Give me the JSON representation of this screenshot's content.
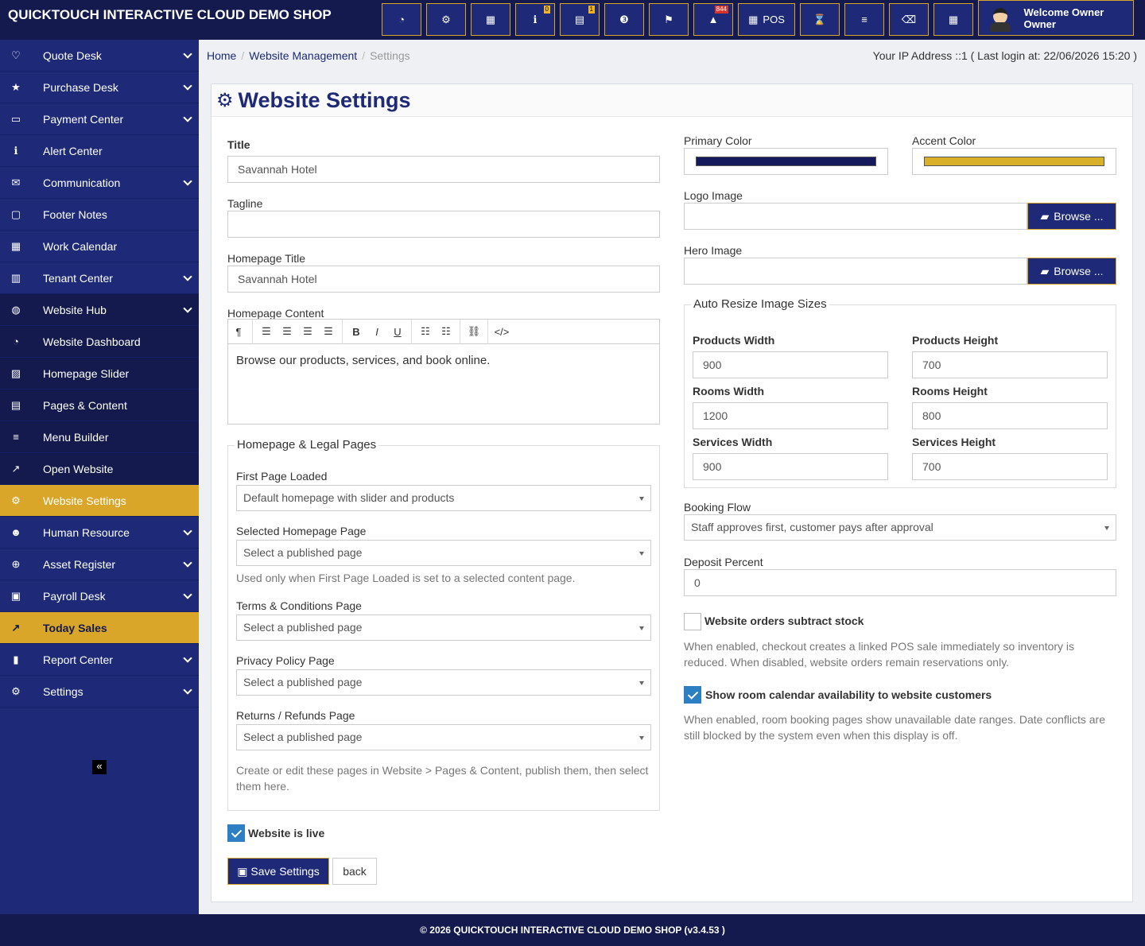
{
  "app": {
    "brand": "QUICKTOUCH INTERACTIVE CLOUD DEMO SHOP",
    "footer": "© 2026 QUICKTOUCH INTERACTIVE CLOUD DEMO SHOP (v3.4.53 )",
    "colors": {
      "primary": "#1e2a78",
      "dark": "#141a4d",
      "accent": "#d9a62a",
      "check": "#2d7fc4"
    }
  },
  "topbar": {
    "buttons": [
      {
        "icon": "dashboard-icon",
        "glyph": "◔"
      },
      {
        "icon": "cogs-icon",
        "glyph": "⚙"
      },
      {
        "icon": "calculator-icon",
        "glyph": "▦"
      },
      {
        "icon": "info-icon",
        "glyph": "ℹ",
        "badge": "0"
      },
      {
        "icon": "calendar-icon",
        "glyph": "▤",
        "badge": "1"
      },
      {
        "icon": "css3-icon",
        "glyph": "❸"
      },
      {
        "icon": "uk-flag-icon",
        "glyph": "⚑"
      },
      {
        "icon": "warning-icon",
        "glyph": "▲",
        "badge": "844"
      },
      {
        "icon": "pos-icon",
        "glyph": "▦",
        "label": "POS"
      },
      {
        "icon": "hourglass-icon",
        "glyph": "⌛"
      },
      {
        "icon": "list-icon",
        "glyph": "≡"
      },
      {
        "icon": "eraser-icon",
        "glyph": "⌫"
      },
      {
        "icon": "windows-icon",
        "glyph": "▦"
      }
    ],
    "welcome": "Welcome Owner Owner"
  },
  "sidebar": {
    "items": [
      {
        "label": "Quote Desk",
        "icon": "heart-icon",
        "glyph": "♡",
        "chevron": true
      },
      {
        "label": "Purchase Desk",
        "icon": "star-icon",
        "glyph": "★",
        "chevron": true
      },
      {
        "label": "Payment Center",
        "icon": "credit-card-icon",
        "glyph": "▭",
        "chevron": true
      },
      {
        "label": "Alert Center",
        "icon": "info-circle-icon",
        "glyph": "ℹ",
        "chevron": false
      },
      {
        "label": "Communication",
        "icon": "comments-icon",
        "glyph": "✉",
        "chevron": true
      },
      {
        "label": "Footer Notes",
        "icon": "sticky-note-icon",
        "glyph": "▢",
        "chevron": false
      },
      {
        "label": "Work Calendar",
        "icon": "calendar-icon",
        "glyph": "▦",
        "chevron": false
      },
      {
        "label": "Tenant Center",
        "icon": "building-icon",
        "glyph": "▥",
        "chevron": true
      },
      {
        "label": "Website Hub",
        "icon": "globe-icon",
        "glyph": "◍",
        "chevron": true,
        "style": "sub"
      },
      {
        "label": "Website Dashboard",
        "icon": "dashboard-icon",
        "glyph": "◔",
        "chevron": false,
        "style": "sub"
      },
      {
        "label": "Homepage Slider",
        "icon": "image-icon",
        "glyph": "▨",
        "chevron": false,
        "style": "sub"
      },
      {
        "label": "Pages & Content",
        "icon": "file-text-icon",
        "glyph": "▤",
        "chevron": false,
        "style": "sub"
      },
      {
        "label": "Menu Builder",
        "icon": "bars-icon",
        "glyph": "≡",
        "chevron": false,
        "style": "sub"
      },
      {
        "label": "Open Website",
        "icon": "external-link-icon",
        "glyph": "↗",
        "chevron": false,
        "style": "sub"
      },
      {
        "label": "Website Settings",
        "icon": "cog-icon",
        "glyph": "⚙",
        "chevron": false,
        "style": "active"
      },
      {
        "label": "Human Resource",
        "icon": "users-icon",
        "glyph": "☻",
        "chevron": true
      },
      {
        "label": "Asset Register",
        "icon": "plus-circle-icon",
        "glyph": "⊕",
        "chevron": true
      },
      {
        "label": "Payroll Desk",
        "icon": "money-icon",
        "glyph": "▣",
        "chevron": true
      },
      {
        "label": "Today Sales",
        "icon": "line-chart-icon",
        "glyph": "↗",
        "chevron": false,
        "style": "today"
      },
      {
        "label": "Report Center",
        "icon": "bar-chart-icon",
        "glyph": "▮",
        "chevron": true
      },
      {
        "label": "Settings",
        "icon": "cog-icon",
        "glyph": "⚙",
        "chevron": true
      }
    ],
    "collapse_glyph": "«"
  },
  "breadcrumb": {
    "home": "Home",
    "section": "Website Management",
    "current": "Settings",
    "sep": "/"
  },
  "ipinfo": "Your IP Address ::1 ( Last login at: 22/06/2026 15:20 )",
  "page": {
    "title": "Website Settings"
  },
  "form": {
    "title": {
      "label": "Title",
      "value": "Savannah Hotel"
    },
    "tagline": {
      "label": "Tagline",
      "value": ""
    },
    "homepage_title": {
      "label": "Homepage Title",
      "value": "Savannah Hotel"
    },
    "homepage_content": {
      "label": "Homepage Content",
      "value": "Browse our products, services, and book online."
    },
    "legal": {
      "legend": "Homepage & Legal Pages",
      "first_page": {
        "label": "First Page Loaded",
        "value": "Default homepage with slider and products"
      },
      "selected_page": {
        "label": "Selected Homepage Page",
        "value": "Select a published page"
      },
      "selected_help": "Used only when First Page Loaded is set to a selected content page.",
      "terms": {
        "label": "Terms & Conditions Page",
        "value": "Select a published page"
      },
      "privacy": {
        "label": "Privacy Policy Page",
        "value": "Select a published page"
      },
      "returns": {
        "label": "Returns / Refunds Page",
        "value": "Select a published page"
      },
      "help": "Create or edit these pages in Website > Pages & Content, publish them, then select them here."
    },
    "website_live": {
      "label": "Website is live",
      "checked": true
    },
    "save": "Save Settings",
    "back": "back",
    "primary_color": {
      "label": "Primary Color",
      "value": "#141a5b"
    },
    "accent_color": {
      "label": "Accent Color",
      "value": "#d9b02a"
    },
    "logo_image": {
      "label": "Logo Image",
      "button": "Browse ..."
    },
    "hero_image": {
      "label": "Hero Image",
      "button": "Browse ..."
    },
    "resize": {
      "legend": "Auto Resize Image Sizes",
      "products_width": {
        "label": "Products Width",
        "value": "900"
      },
      "products_height": {
        "label": "Products Height",
        "value": "700"
      },
      "rooms_width": {
        "label": "Rooms Width",
        "value": "1200"
      },
      "rooms_height": {
        "label": "Rooms Height",
        "value": "800"
      },
      "services_width": {
        "label": "Services Width",
        "value": "900"
      },
      "services_height": {
        "label": "Services Height",
        "value": "700"
      }
    },
    "booking_flow": {
      "label": "Booking Flow",
      "value": "Staff approves first, customer pays after approval"
    },
    "deposit_percent": {
      "label": "Deposit Percent",
      "value": "0"
    },
    "subtract_stock": {
      "label": "Website orders subtract stock",
      "checked": false,
      "help": "When enabled, checkout creates a linked POS sale immediately so inventory is reduced. When disabled, website orders remain reservations only."
    },
    "room_calendar": {
      "label": "Show room calendar availability to website customers",
      "checked": true,
      "help": "When enabled, room booking pages show unavailable date ranges. Date conflicts are still blocked by the system even when this display is off."
    }
  },
  "editor_toolbar": [
    {
      "icon": "paragraph-icon",
      "glyph": "¶"
    },
    {
      "sep": true
    },
    {
      "icon": "align-left-icon",
      "glyph": "☰"
    },
    {
      "icon": "align-center-icon",
      "glyph": "☰"
    },
    {
      "icon": "align-right-icon",
      "glyph": "☰"
    },
    {
      "icon": "align-justify-icon",
      "glyph": "☰"
    },
    {
      "sep": true
    },
    {
      "icon": "bold-icon",
      "glyph": "B"
    },
    {
      "icon": "italic-icon",
      "glyph": "I"
    },
    {
      "icon": "underline-icon",
      "glyph": "U"
    },
    {
      "sep": true
    },
    {
      "icon": "bullet-list-icon",
      "glyph": "☷"
    },
    {
      "icon": "numbered-list-icon",
      "glyph": "☷"
    },
    {
      "sep": true
    },
    {
      "icon": "link-icon",
      "glyph": "⛓"
    },
    {
      "sep": true
    },
    {
      "icon": "code-icon",
      "glyph": "</>"
    }
  ]
}
